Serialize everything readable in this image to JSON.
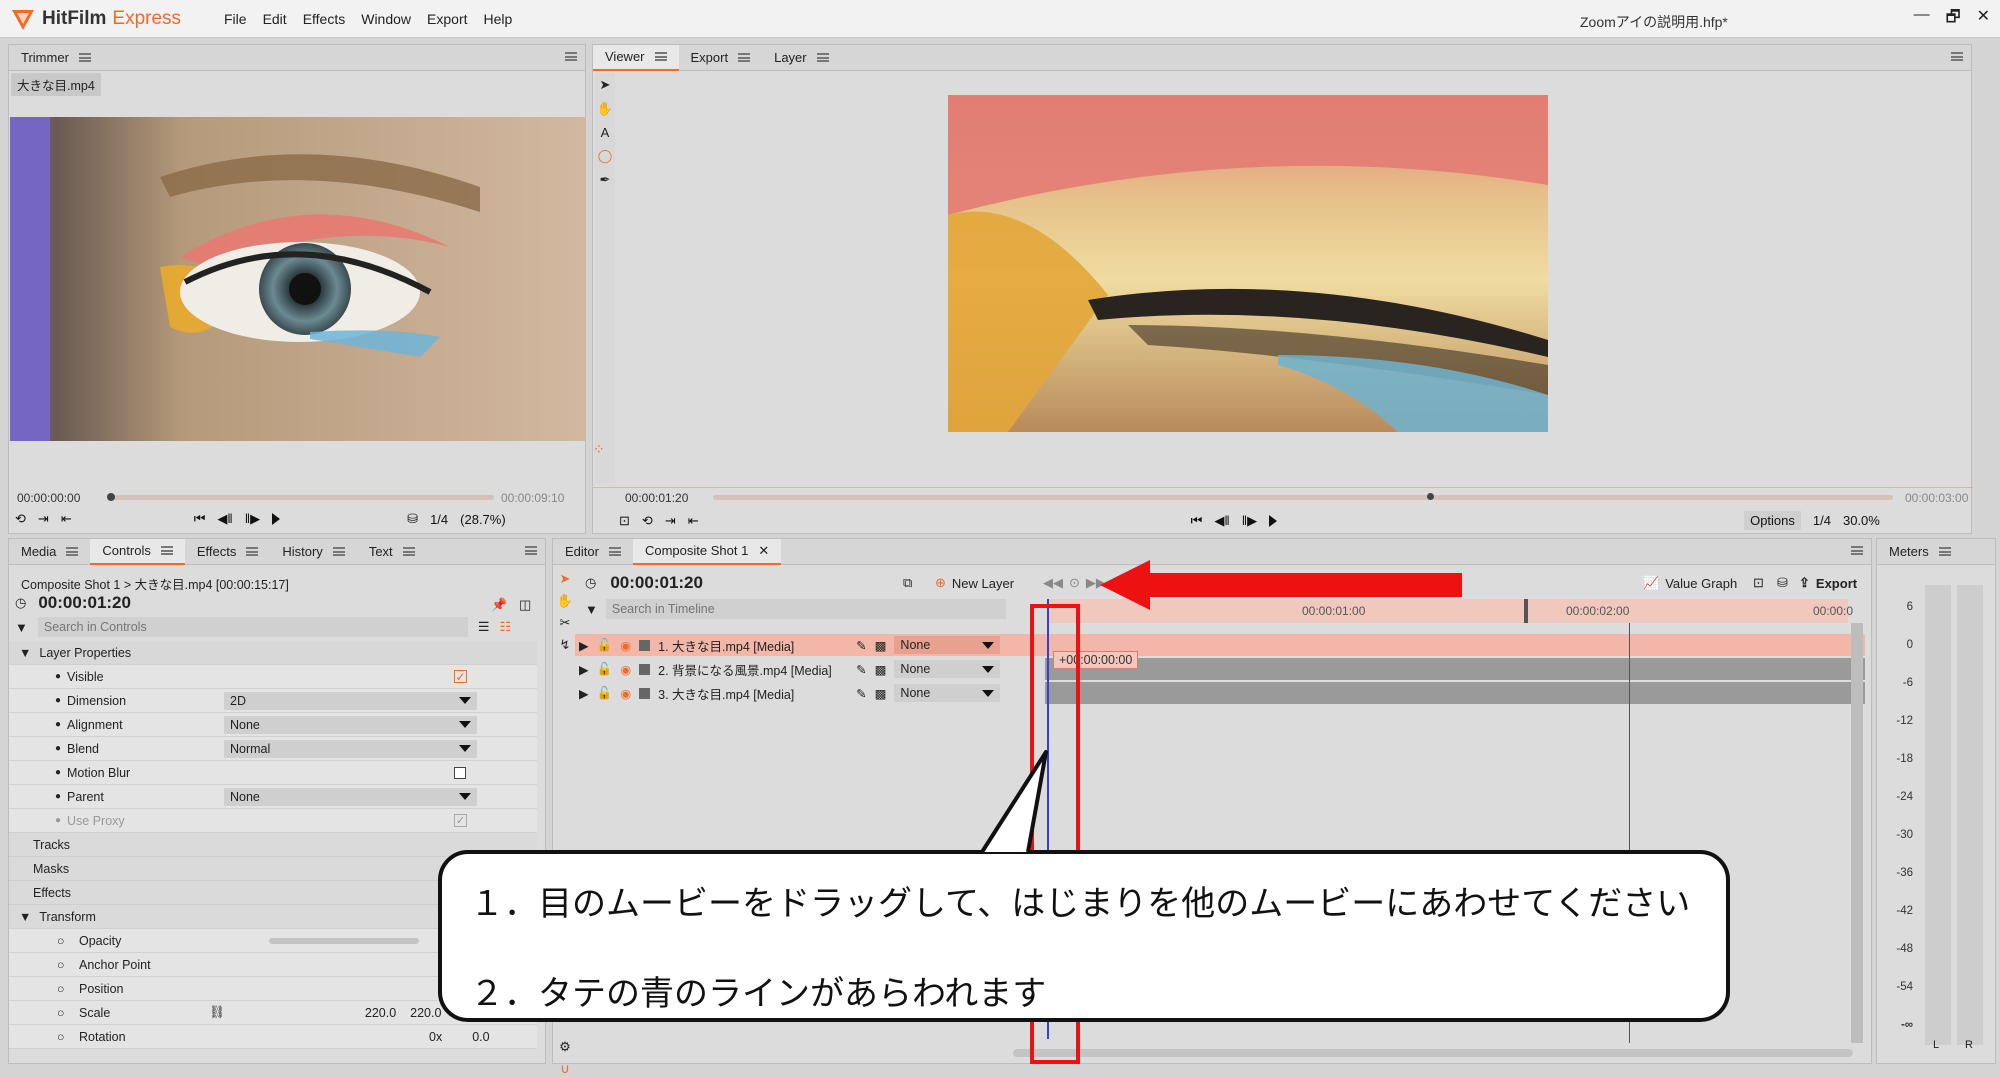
{
  "app": {
    "name_part1": "HitFilm",
    "name_part2": "Express",
    "project_title": "Zoomアイの説明用.hfp*",
    "menu": [
      "File",
      "Edit",
      "Effects",
      "Window",
      "Export",
      "Help"
    ],
    "window_controls": [
      "—",
      "🗗",
      "✕"
    ]
  },
  "trimmer": {
    "tab": "Trimmer",
    "file_tab": "大きな目.mp4",
    "tc_start": "00:00:00:00",
    "tc_end": "00:00:09:10",
    "res": "1/4",
    "zoom": "(28.7%)",
    "progress": 0.0
  },
  "viewer": {
    "tabs": [
      "Viewer",
      "Export",
      "Layer"
    ],
    "tc_current": "00:00:01:20",
    "tc_end": "00:00:03:00",
    "options": "Options",
    "res": "1/4",
    "zoom": "30.0%",
    "progress": 0.6
  },
  "left_tabs": [
    "Media",
    "Controls",
    "Effects",
    "History",
    "Text"
  ],
  "controls": {
    "breadcrumb": "Composite Shot 1 > 大きな目.mp4 [00:00:15:17]",
    "timecode": "00:00:01:20",
    "search_placeholder": "Search in Controls",
    "layer_properties": "Layer Properties",
    "props": [
      {
        "label": "Visible",
        "kind": "check",
        "value": "✓"
      },
      {
        "label": "Dimension",
        "kind": "dd",
        "value": "2D"
      },
      {
        "label": "Alignment",
        "kind": "dd",
        "value": "None"
      },
      {
        "label": "Blend",
        "kind": "dd",
        "value": "Normal"
      },
      {
        "label": "Motion Blur",
        "kind": "check",
        "value": ""
      },
      {
        "label": "Parent",
        "kind": "dd",
        "value": "None"
      },
      {
        "label": "Use Proxy",
        "kind": "check",
        "value": "✓"
      }
    ],
    "sections": [
      "Tracks",
      "Masks",
      "Effects"
    ],
    "transform": "Transform",
    "transform_props": [
      {
        "label": "Opacity",
        "v1": "",
        "v2": ""
      },
      {
        "label": "Anchor Point",
        "v1": "",
        "v2": ""
      },
      {
        "label": "Position",
        "v1": "",
        "v2": ""
      },
      {
        "label": "Scale",
        "v1": "220.0",
        "v2": "220.0"
      },
      {
        "label": "Rotation",
        "v1": "0x",
        "v2": "0.0"
      }
    ]
  },
  "editor": {
    "tabs": [
      "Editor",
      "Composite Shot 1"
    ],
    "timecode": "00:00:01:20",
    "new_layer": "New Layer",
    "value_graph": "Value Graph",
    "export": "Export",
    "search_placeholder": "Search in Timeline",
    "ruler": [
      "00:00:01:00",
      "00:00:02:00",
      "00:00:0"
    ],
    "layers": [
      {
        "name": "1. 大きな目.mp4 [Media]",
        "blend": "None"
      },
      {
        "name": "2. 背景になる風景.mp4 [Media]",
        "blend": "None"
      },
      {
        "name": "3. 大きな目.mp4 [Media]",
        "blend": "None"
      }
    ],
    "offset_tooltip": "+00:00:00:00"
  },
  "meters": {
    "tab": "Meters",
    "scale": [
      "6",
      "0",
      "-6",
      "-12",
      "-18",
      "-24",
      "-30",
      "-36",
      "-42",
      "-48",
      "-54",
      "-∞"
    ],
    "channels": [
      "L",
      "R"
    ]
  },
  "callout": {
    "line1": "１．目のムービーをドラッグして、はじまりを他のムービーにあわせてください",
    "line2": "２．タテの青のラインがあらわれます"
  },
  "colors": {
    "accent": "#f06a28",
    "annotation_red": "#ee1111",
    "playhead_blue": "#3340d8"
  }
}
